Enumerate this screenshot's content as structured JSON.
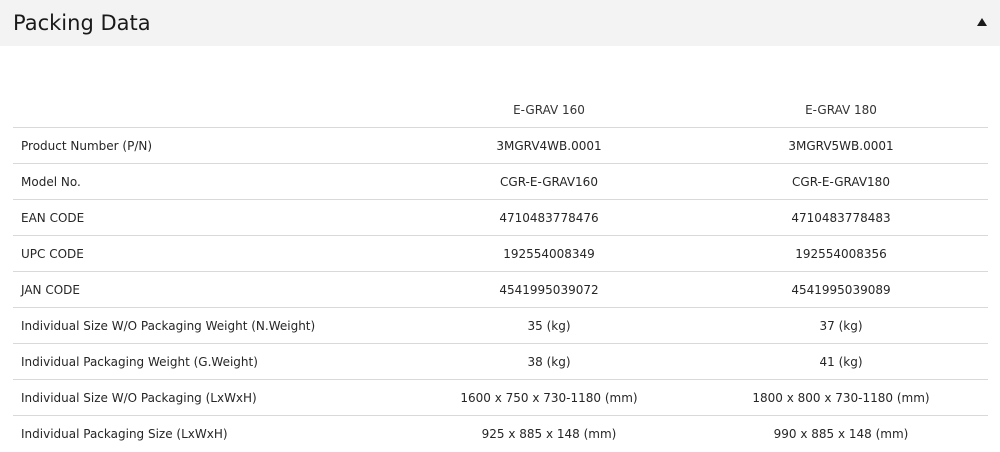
{
  "header": {
    "title": "Packing Data",
    "toggle_icon": "caret-up-icon"
  },
  "table": {
    "columns": [
      "E-GRAV 160",
      "E-GRAV 180"
    ],
    "rows": [
      {
        "label": "Product Number (P/N)",
        "values": [
          "3MGRV4WB.0001",
          "3MGRV5WB.0001"
        ]
      },
      {
        "label": "Model No.",
        "values": [
          "CGR-E-GRAV160",
          "CGR-E-GRAV180"
        ]
      },
      {
        "label": "EAN CODE",
        "values": [
          "4710483778476",
          "4710483778483"
        ]
      },
      {
        "label": "UPC CODE",
        "values": [
          "192554008349",
          "192554008356"
        ]
      },
      {
        "label": "JAN CODE",
        "values": [
          "4541995039072",
          "4541995039089"
        ]
      },
      {
        "label": "Individual Size W/O Packaging Weight (N.Weight)",
        "values": [
          "35 (kg)",
          "37 (kg)"
        ]
      },
      {
        "label": "Individual Packaging Weight (G.Weight)",
        "values": [
          "38 (kg)",
          "41 (kg)"
        ]
      },
      {
        "label": "Individual Size W/O Packaging (LxWxH)",
        "values": [
          "1600 x 750 x 730-1180 (mm)",
          "1800 x 800 x 730-1180 (mm)"
        ]
      },
      {
        "label": "Individual Packaging Size (LxWxH)",
        "values": [
          "925 x 885 x 148 (mm)",
          "990 x 885 x 148 (mm)"
        ]
      }
    ]
  }
}
